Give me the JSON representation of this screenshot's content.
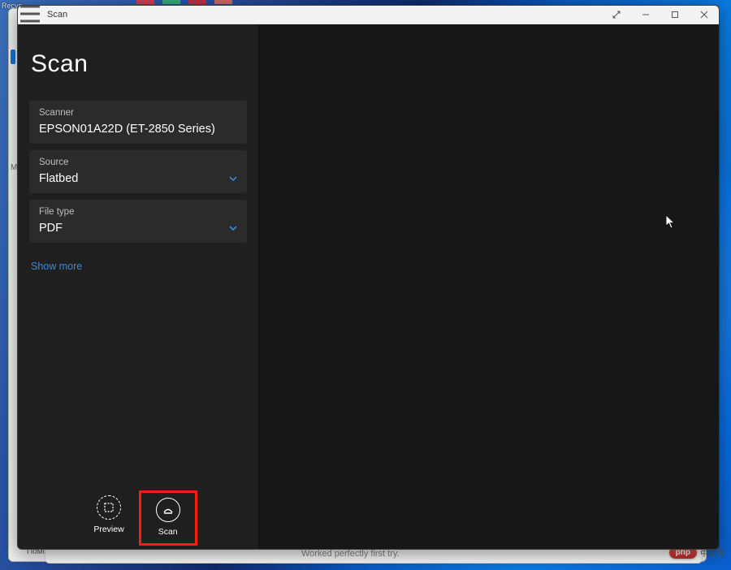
{
  "desktop": {
    "icon_label": "Recyc..."
  },
  "background_window": {
    "left_marker": "Mo",
    "help": "Помо",
    "bottom_text": "Worked perfectly first try."
  },
  "watermark": {
    "badge": "php",
    "suffix": "中文网"
  },
  "window": {
    "title": "Scan"
  },
  "sidebar": {
    "app_title": "Scan",
    "fields": {
      "scanner": {
        "label": "Scanner",
        "value": "EPSON01A22D (ET-2850 Series)"
      },
      "source": {
        "label": "Source",
        "value": "Flatbed"
      },
      "filetype": {
        "label": "File type",
        "value": "PDF"
      }
    },
    "show_more": "Show more",
    "actions": {
      "preview": "Preview",
      "scan": "Scan"
    }
  }
}
